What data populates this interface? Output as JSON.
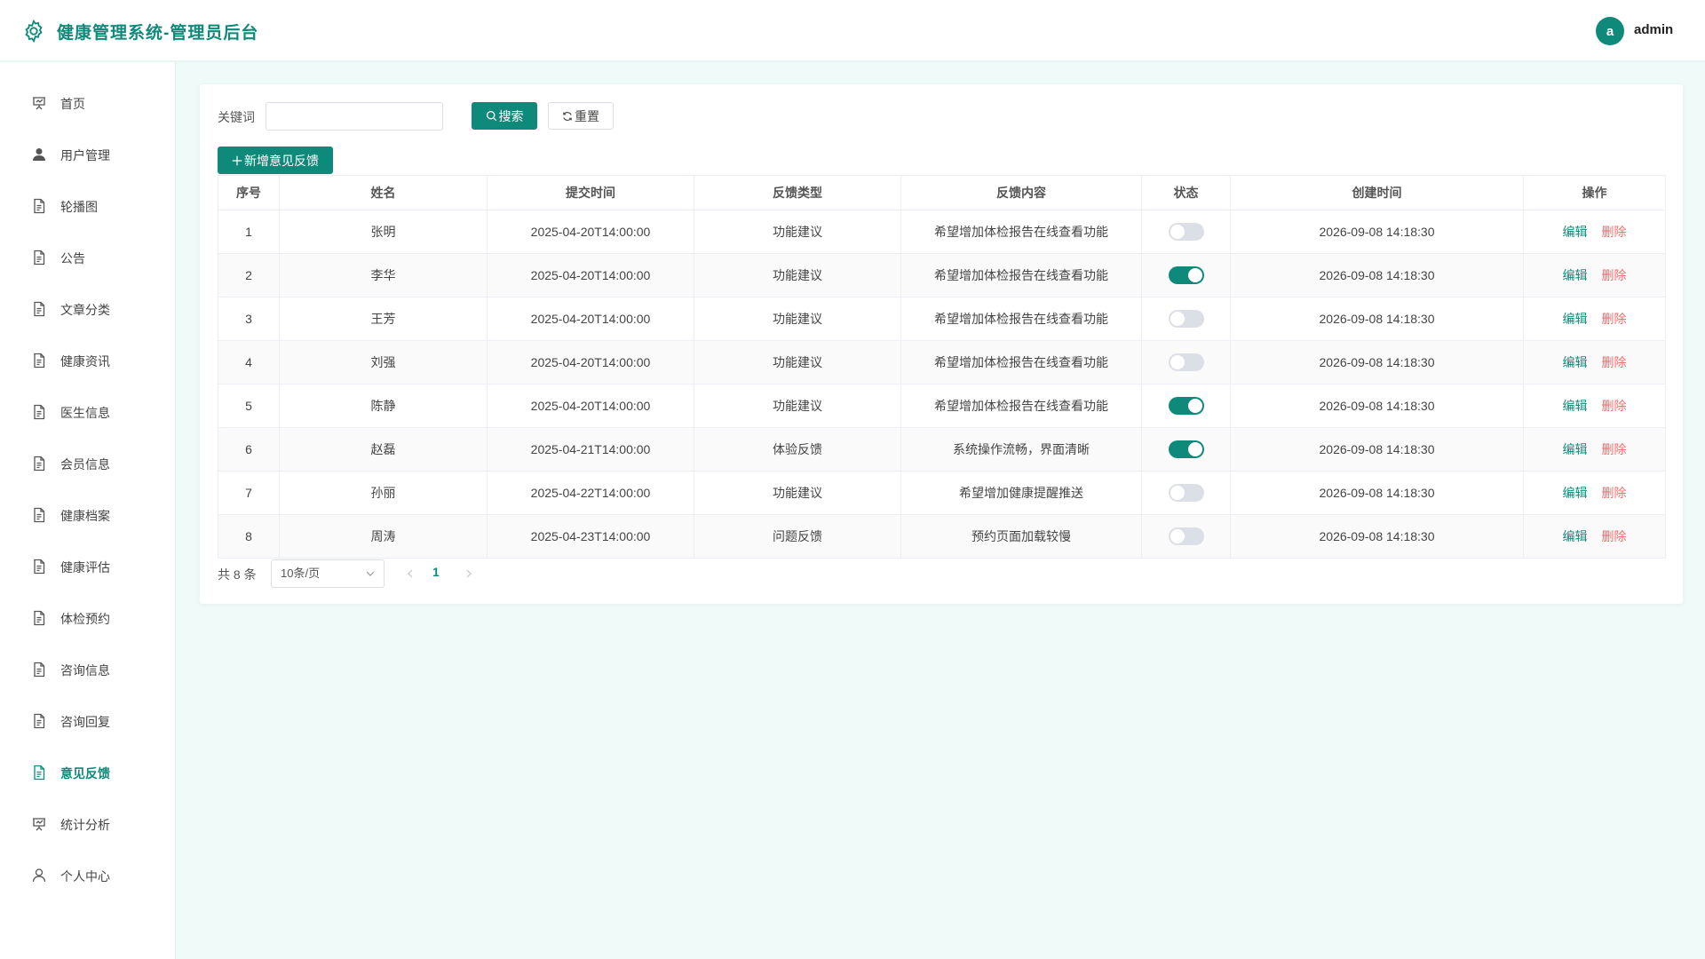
{
  "header": {
    "title": "健康管理系统-管理员后台",
    "avatar_letter": "a",
    "username": "admin"
  },
  "sidebar": {
    "items": [
      {
        "label": "首页",
        "icon": "presentation-icon"
      },
      {
        "label": "用户管理",
        "icon": "user-filled-icon"
      },
      {
        "label": "轮播图",
        "icon": "document-icon"
      },
      {
        "label": "公告",
        "icon": "document-icon"
      },
      {
        "label": "文章分类",
        "icon": "document-icon"
      },
      {
        "label": "健康资讯",
        "icon": "document-icon"
      },
      {
        "label": "医生信息",
        "icon": "document-icon"
      },
      {
        "label": "会员信息",
        "icon": "document-icon"
      },
      {
        "label": "健康档案",
        "icon": "document-icon"
      },
      {
        "label": "健康评估",
        "icon": "document-icon"
      },
      {
        "label": "体检预约",
        "icon": "document-icon"
      },
      {
        "label": "咨询信息",
        "icon": "document-icon"
      },
      {
        "label": "咨询回复",
        "icon": "document-icon"
      },
      {
        "label": "意见反馈",
        "icon": "document-icon",
        "active": true
      },
      {
        "label": "统计分析",
        "icon": "presentation-icon"
      },
      {
        "label": "个人中心",
        "icon": "user-outline-icon"
      }
    ]
  },
  "search": {
    "keyword_label": "关键词",
    "keyword_value": "",
    "search_label": "搜索",
    "reset_label": "重置"
  },
  "toolbar": {
    "add_label": "新增意见反馈"
  },
  "table": {
    "columns": [
      "序号",
      "姓名",
      "提交时间",
      "反馈类型",
      "反馈内容",
      "状态",
      "创建时间",
      "操作"
    ],
    "edit_label": "编辑",
    "delete_label": "删除",
    "rows": [
      {
        "index": "1",
        "name": "张明",
        "submit_time": "2025-04-20T14:00:00",
        "type": "功能建议",
        "content": "希望增加体检报告在线查看功能",
        "status": false,
        "created": "2026-09-08 14:18:30"
      },
      {
        "index": "2",
        "name": "李华",
        "submit_time": "2025-04-20T14:00:00",
        "type": "功能建议",
        "content": "希望增加体检报告在线查看功能",
        "status": true,
        "created": "2026-09-08 14:18:30"
      },
      {
        "index": "3",
        "name": "王芳",
        "submit_time": "2025-04-20T14:00:00",
        "type": "功能建议",
        "content": "希望增加体检报告在线查看功能",
        "status": false,
        "created": "2026-09-08 14:18:30"
      },
      {
        "index": "4",
        "name": "刘强",
        "submit_time": "2025-04-20T14:00:00",
        "type": "功能建议",
        "content": "希望增加体检报告在线查看功能",
        "status": false,
        "created": "2026-09-08 14:18:30"
      },
      {
        "index": "5",
        "name": "陈静",
        "submit_time": "2025-04-20T14:00:00",
        "type": "功能建议",
        "content": "希望增加体检报告在线查看功能",
        "status": true,
        "created": "2026-09-08 14:18:30"
      },
      {
        "index": "6",
        "name": "赵磊",
        "submit_time": "2025-04-21T14:00:00",
        "type": "体验反馈",
        "content": "系统操作流畅，界面清晰",
        "status": true,
        "created": "2026-09-08 14:18:30"
      },
      {
        "index": "7",
        "name": "孙丽",
        "submit_time": "2025-04-22T14:00:00",
        "type": "功能建议",
        "content": "希望增加健康提醒推送",
        "status": false,
        "created": "2026-09-08 14:18:30"
      },
      {
        "index": "8",
        "name": "周涛",
        "submit_time": "2025-04-23T14:00:00",
        "type": "问题反馈",
        "content": "预约页面加载较慢",
        "status": false,
        "created": "2026-09-08 14:18:30"
      }
    ]
  },
  "pagination": {
    "total_label": "共 8 条",
    "page_size": "10条/页",
    "current_page": "1"
  },
  "colors": {
    "accent": "#0f8a7a",
    "danger": "#f56c6c",
    "background": "#f0fbf9"
  }
}
